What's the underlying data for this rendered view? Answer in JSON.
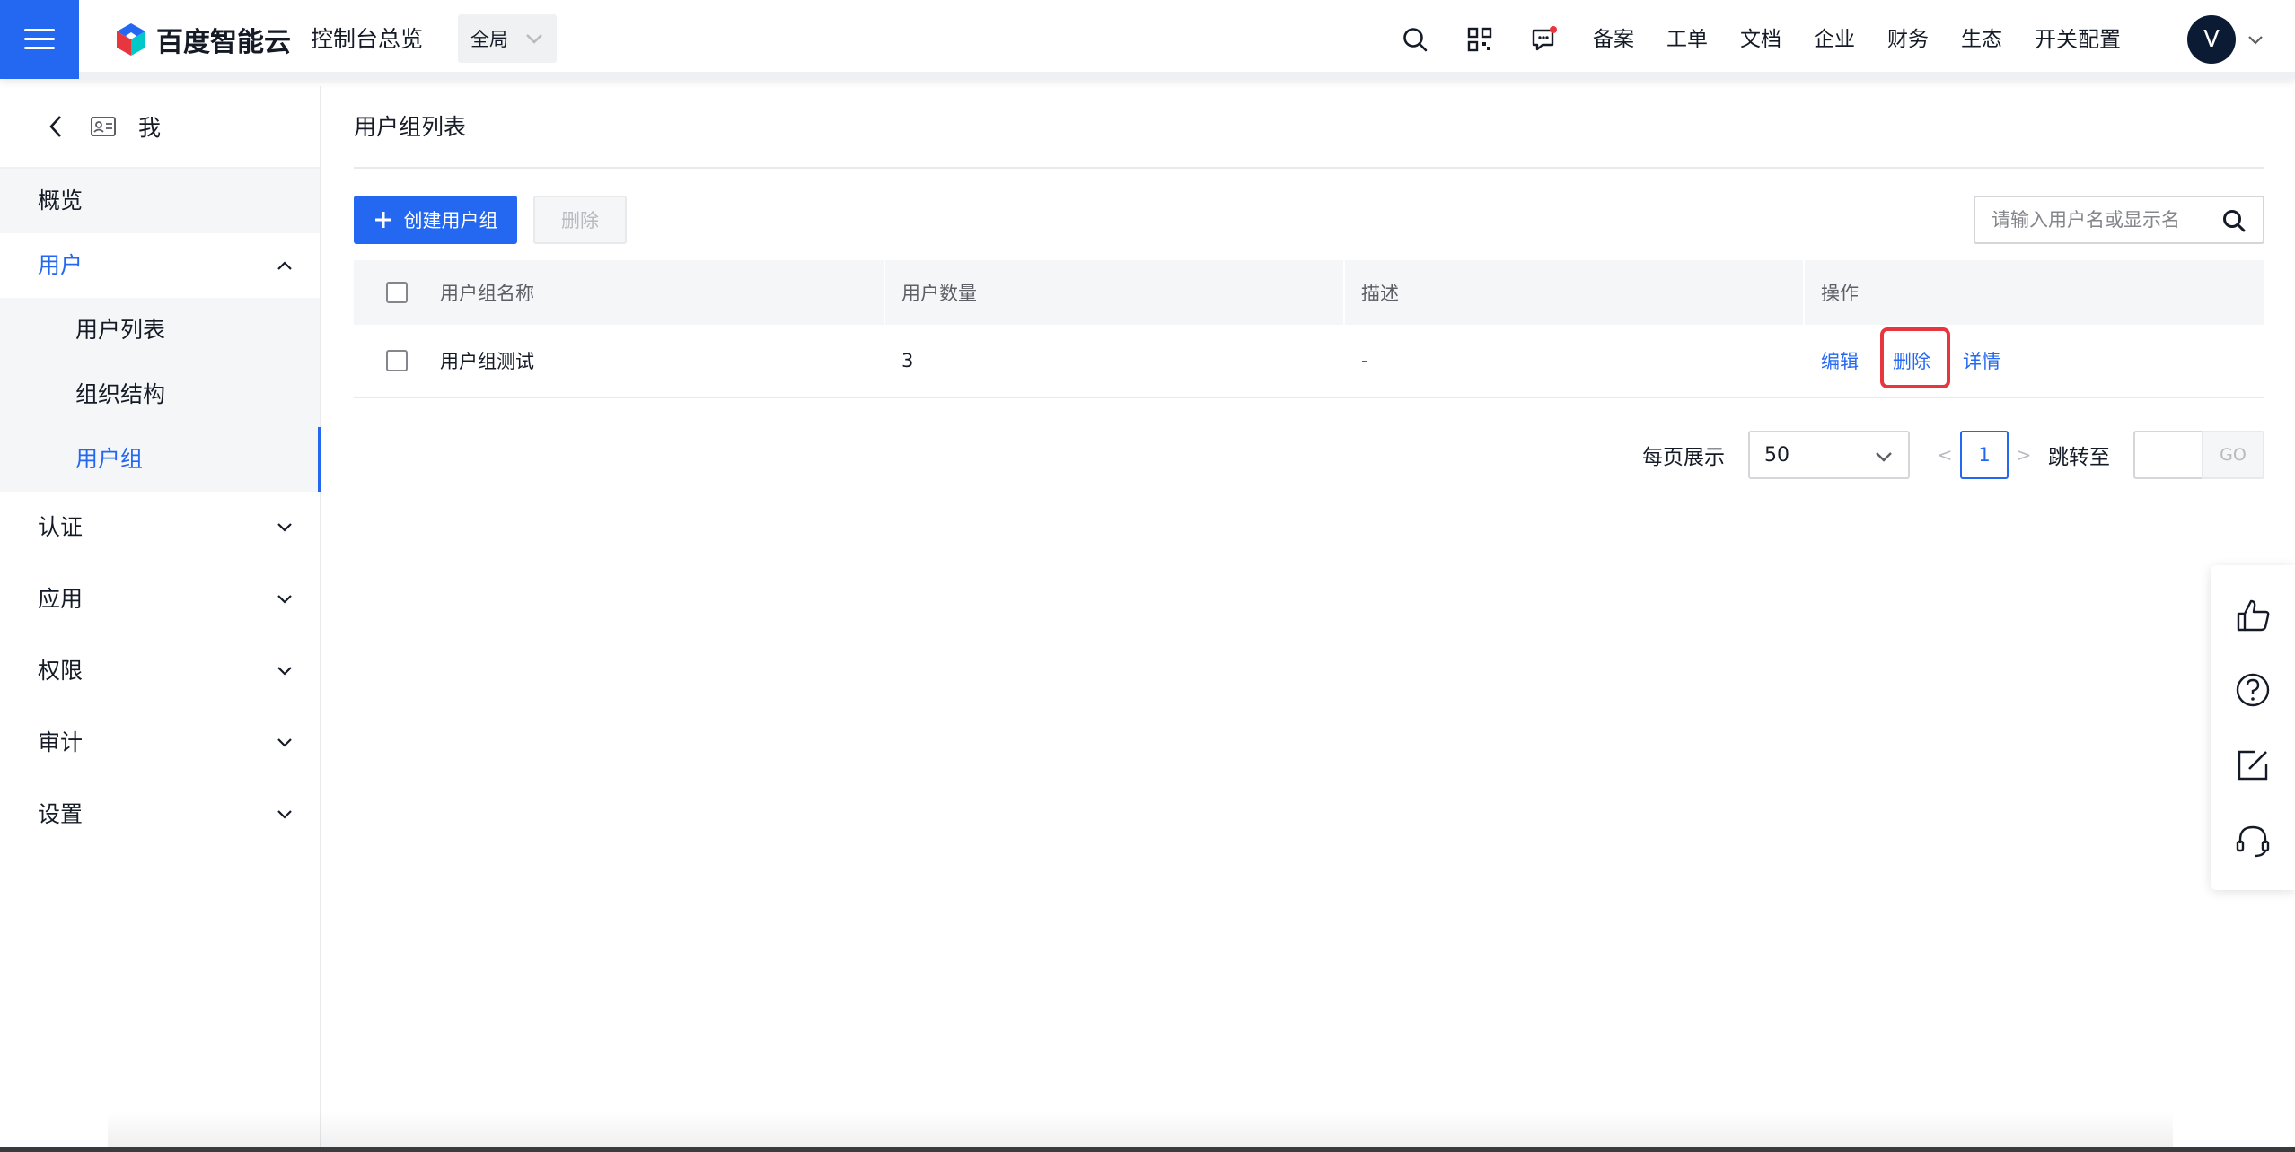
{
  "header": {
    "brand": "百度智能云",
    "console_title": "控制台总览",
    "region": "全局",
    "nav_links": [
      "备案",
      "工单",
      "文档",
      "企业",
      "财务",
      "生态",
      "开关配置"
    ],
    "avatar_letter": "V",
    "colors": {
      "primary": "#2468f2",
      "notification_dot": "#e8363f",
      "avatar_bg": "#0b1b34"
    }
  },
  "sidebar": {
    "header_label": "我",
    "items": [
      {
        "label": "概览"
      },
      {
        "label": "用户",
        "expanded": true,
        "children": [
          "用户列表",
          "组织结构",
          "用户组"
        ],
        "active_child": "用户组"
      },
      {
        "label": "认证"
      },
      {
        "label": "应用"
      },
      {
        "label": "权限"
      },
      {
        "label": "审计"
      },
      {
        "label": "设置"
      }
    ]
  },
  "main": {
    "page_title": "用户组列表",
    "toolbar": {
      "create_label": "创建用户组",
      "delete_label": "删除",
      "search_placeholder": "请输入用户名或显示名"
    },
    "table": {
      "columns": [
        "用户组名称",
        "用户数量",
        "描述",
        "操作"
      ],
      "rows": [
        {
          "name": "用户组测试",
          "count": "3",
          "desc": "-",
          "ops": [
            "编辑",
            "删除",
            "详情"
          ]
        }
      ]
    },
    "pagination": {
      "page_size_label": "每页展示",
      "page_size": "50",
      "prev": "<",
      "current_page": "1",
      "next": ">",
      "jump_label": "跳转至",
      "go_label": "GO"
    }
  },
  "float_tools": [
    "thumbs-up-icon",
    "help-icon",
    "edit-icon",
    "headset-icon"
  ]
}
